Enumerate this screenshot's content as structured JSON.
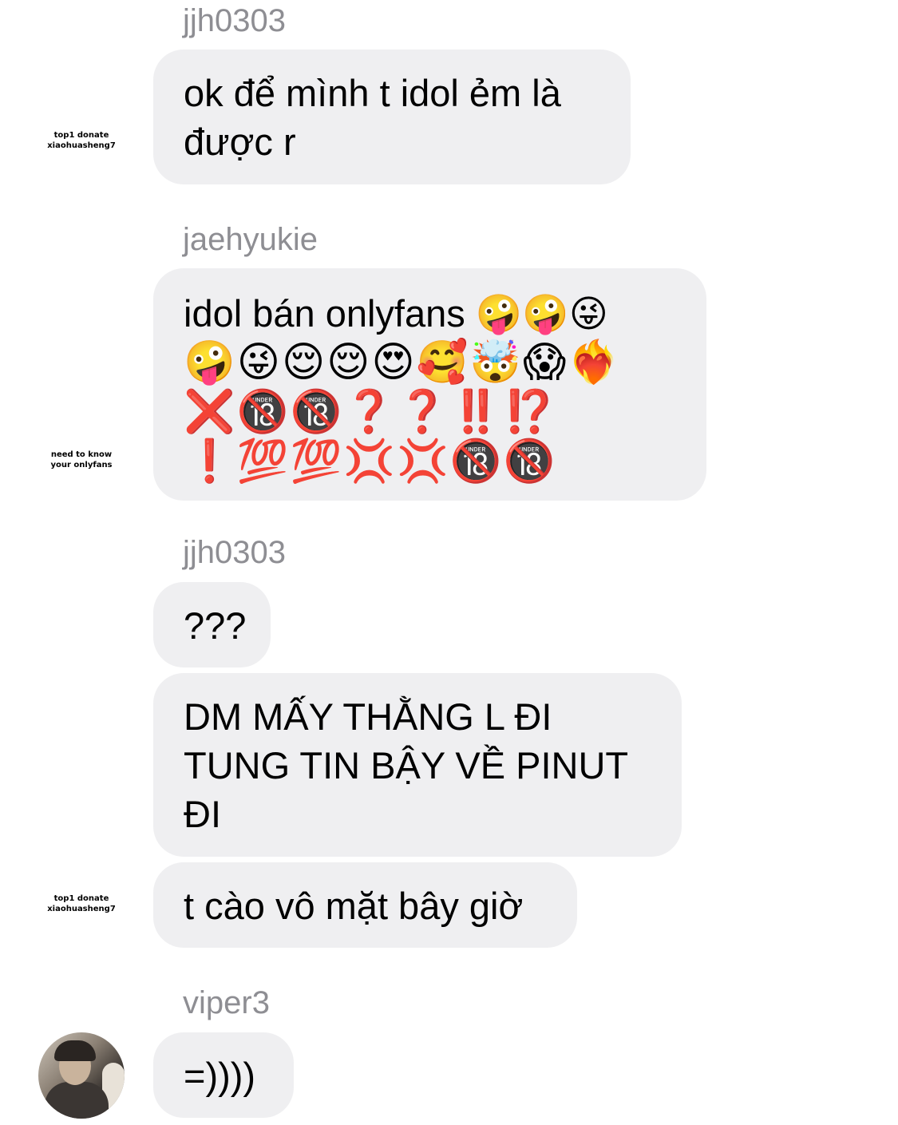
{
  "messages": [
    {
      "username": "jjh0303",
      "bubbles": [
        {
          "text": "ok để mình t idol ẻm là\nđược r"
        }
      ],
      "sticker": [
        "top1 donate",
        "xiaohuasheng7"
      ]
    },
    {
      "username": "jaehyukie",
      "bubbles": [
        {
          "text": "idol bán onlyfans 🤪🤪😜",
          "emoji_lines": [
            "🤪😜😌😌😍🥰🤯😱❤️‍🔥",
            "❌🔞🔞❓❓‼️⁉️",
            "❗💯💯💢💢🔞🔞"
          ]
        }
      ],
      "sticker": [
        "need to know",
        "your onlyfans"
      ]
    },
    {
      "username": "jjh0303",
      "bubbles": [
        {
          "text": "???"
        },
        {
          "text": "DM MẤY THẰNG L ĐI\nTUNG TIN BẬY VỀ PINUT\nĐI"
        },
        {
          "text": "t cào vô mặt bây giờ"
        }
      ],
      "sticker": [
        "top1 donate",
        "xiaohuasheng7"
      ]
    },
    {
      "username": "viper3",
      "bubbles": [
        {
          "text": "=))))"
        }
      ],
      "avatar_icon": "user-photo-avatar"
    }
  ]
}
